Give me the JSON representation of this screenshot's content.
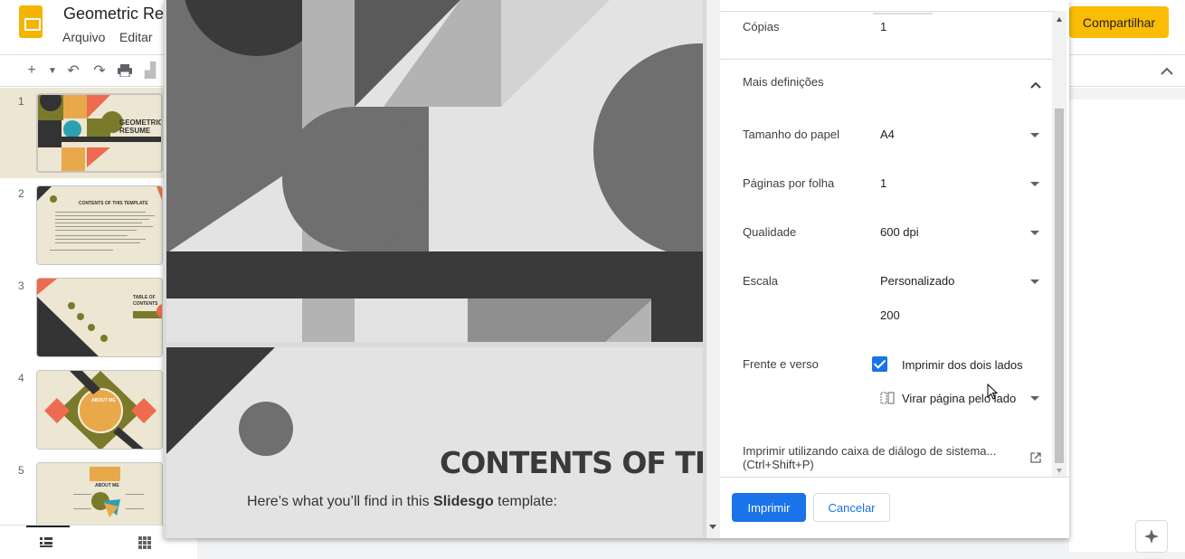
{
  "app": {
    "title": "Geometric Re",
    "menu": [
      "Arquivo",
      "Editar"
    ],
    "share_label": "Compartilhar"
  },
  "filmstrip": {
    "slides": [
      {
        "number": "1",
        "thumb_title": "GEOMETRIC RESUME"
      },
      {
        "number": "2",
        "thumb_title": "CONTENTS OF THIS TEMPLATE"
      },
      {
        "number": "3",
        "thumb_title": "TABLE OF CONTENTS"
      },
      {
        "number": "4",
        "thumb_title": "ABOUT ME"
      },
      {
        "number": "5",
        "thumb_title": "ABOUT ME"
      }
    ]
  },
  "preview": {
    "page2_heading": "CONTENTS OF THIS TI",
    "page2_sub_before": "Here’s what you’ll find in this ",
    "page2_sub_bold": "Slidesgo",
    "page2_sub_after": " template:"
  },
  "print_settings": {
    "copies_label": "Cópias",
    "copies_value": "1",
    "more_settings_label": "Mais definições",
    "paper_size_label": "Tamanho do papel",
    "paper_size_value": "A4",
    "pages_per_sheet_label": "Páginas por folha",
    "pages_per_sheet_value": "1",
    "quality_label": "Qualidade",
    "quality_value": "600 dpi",
    "scale_label": "Escala",
    "scale_value": "Personalizado",
    "scale_custom_value": "200",
    "duplex_label": "Frente e verso",
    "duplex_checkbox_label": "Imprimir dos dois lados",
    "flip_label": "Virar página pelo lado",
    "system_dialog_label": "Imprimir utilizando caixa de diálogo de sistema...",
    "system_dialog_shortcut": "(Ctrl+Shift+P)",
    "print_label": "Imprimir",
    "cancel_label": "Cancelar"
  },
  "colors": {
    "accent_blue": "#1a73e8",
    "share_yellow": "#fbbc04",
    "slides_logo": "#f4b400"
  }
}
